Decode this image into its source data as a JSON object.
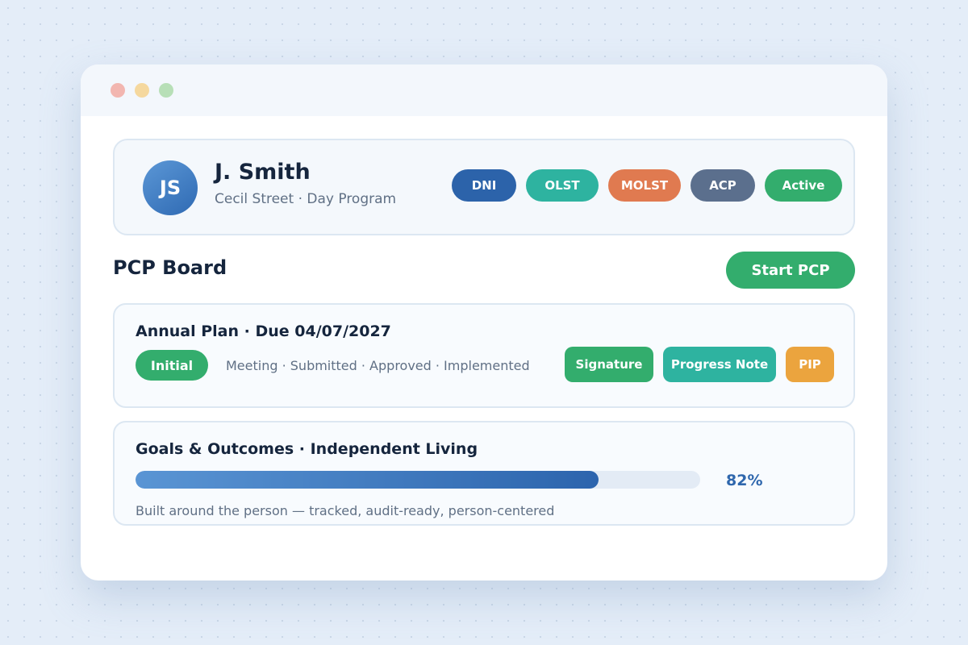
{
  "profile": {
    "initials": "JS",
    "name": "J. Smith",
    "subtitle": "Cecil Street · Day Program",
    "badges": [
      {
        "label": "DNI",
        "color": "#2c63aa"
      },
      {
        "label": "OLST",
        "color": "#2eb3a0"
      },
      {
        "label": "MOLST",
        "color": "#e07a50"
      },
      {
        "label": "ACP",
        "color": "#5b6f8d"
      },
      {
        "label": "Active",
        "color": "#33ad6d"
      }
    ]
  },
  "board": {
    "title": "PCP Board",
    "start_button_label": "Start PCP"
  },
  "plan_card": {
    "title": "Annual Plan · Due 04/07/2027",
    "current_stage": "Initial",
    "stages": "Meeting · Submitted · Approved · Implemented",
    "actions": [
      {
        "label": "Signature",
        "color": "#33ad6d"
      },
      {
        "label": "Progress Note",
        "color": "#2eb3a0"
      },
      {
        "label": "PIP",
        "color": "#eba43e"
      }
    ]
  },
  "goals_card": {
    "title": "Goals & Outcomes · Independent Living",
    "progress_percent": 82,
    "progress_label": "82%",
    "caption": "Built around the person — tracked, audit-ready, person-centered"
  },
  "colors": {
    "accent_blue": "#2c63aa",
    "accent_green": "#33ad6d",
    "text_dark": "#15253d",
    "text_muted": "#607085"
  }
}
